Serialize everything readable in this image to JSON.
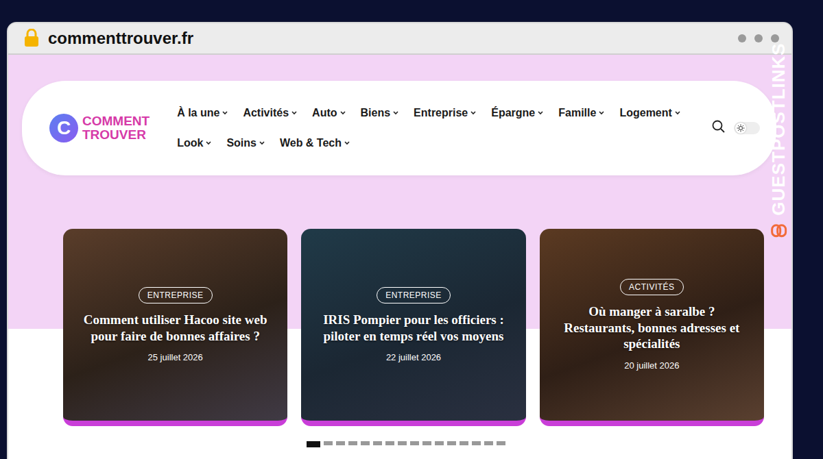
{
  "browser": {
    "url": "commenttrouver.fr"
  },
  "watermark": {
    "text": "GUESTPOSTLINKS"
  },
  "logo": {
    "mark": "C",
    "line1": "COMMENT",
    "line2": "TROUVER"
  },
  "nav": [
    {
      "label": "À la une"
    },
    {
      "label": "Activités"
    },
    {
      "label": "Auto"
    },
    {
      "label": "Biens"
    },
    {
      "label": "Entreprise"
    },
    {
      "label": "Épargne"
    },
    {
      "label": "Famille"
    },
    {
      "label": "Logement"
    },
    {
      "label": "Look"
    },
    {
      "label": "Soins"
    },
    {
      "label": "Web & Tech"
    }
  ],
  "theme_toggle": {
    "on": false
  },
  "cards": [
    {
      "tag": "ENTREPRISE",
      "title": "Comment utiliser Hacoo site web pour faire de bonnes affaires ?",
      "date": "25 juillet 2026"
    },
    {
      "tag": "ENTREPRISE",
      "title": "IRIS Pompier pour les officiers : piloter en temps réel vos moyens",
      "date": "22 juillet 2026"
    },
    {
      "tag": "ACTIVITÉS",
      "title": "Où manger à saralbe ? Restaurants, bonnes adresses et spécialités",
      "date": "20 juillet 2026"
    }
  ],
  "carousel": {
    "dots": [
      {
        "selected": true
      },
      {
        "selected": false
      },
      {
        "selected": false
      },
      {
        "selected": false
      },
      {
        "selected": false
      },
      {
        "selected": false
      },
      {
        "selected": false
      },
      {
        "selected": false
      },
      {
        "selected": false
      },
      {
        "selected": false
      },
      {
        "selected": false
      },
      {
        "selected": false
      },
      {
        "selected": false
      },
      {
        "selected": false
      },
      {
        "selected": false
      },
      {
        "selected": false
      }
    ]
  }
}
